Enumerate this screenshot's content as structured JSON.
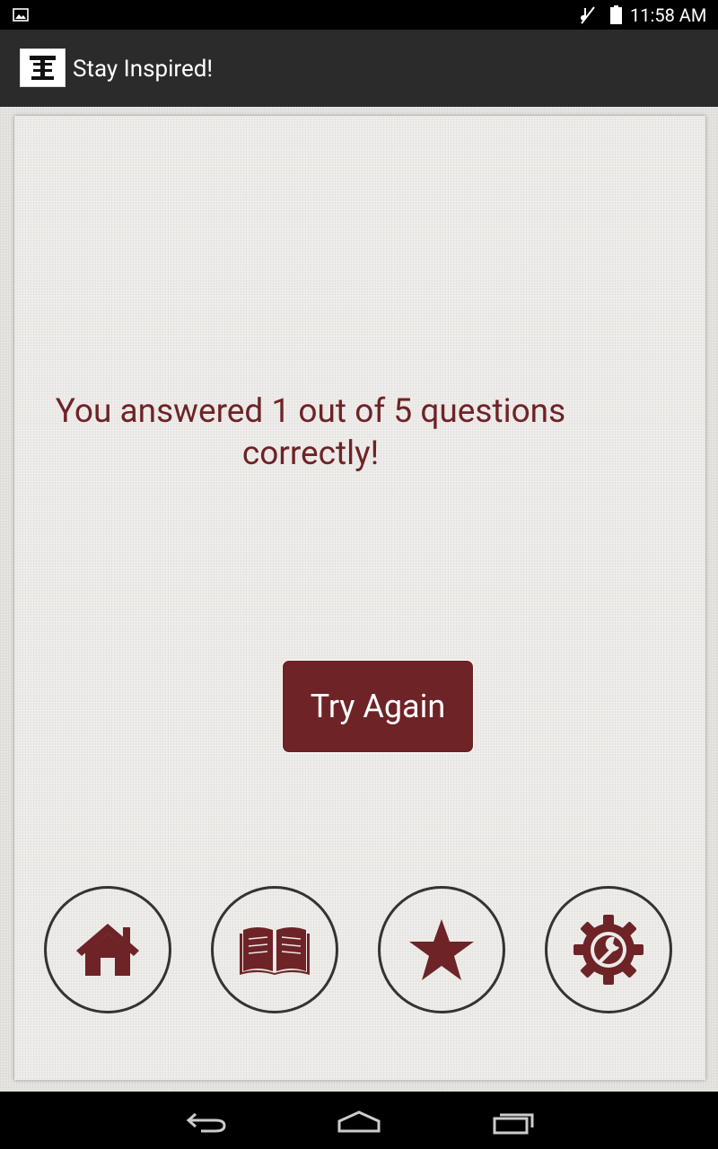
{
  "status_bar": {
    "time": "11:58 AM",
    "icons": [
      "image-notification-icon",
      "mute-icon",
      "battery-icon"
    ]
  },
  "action_bar": {
    "title": "Stay Inspired!",
    "logo_icon": "t-logo-icon"
  },
  "result": {
    "message": "You answered 1 out of 5 questions correctly!"
  },
  "buttons": {
    "try_again": "Try Again"
  },
  "bottom_nav": {
    "items": [
      {
        "name": "home",
        "icon": "home-icon"
      },
      {
        "name": "book",
        "icon": "book-icon"
      },
      {
        "name": "favorites",
        "icon": "star-icon"
      },
      {
        "name": "settings",
        "icon": "settings-gear-icon"
      }
    ]
  },
  "system_nav": [
    "back-icon",
    "home-button-icon",
    "recents-icon"
  ],
  "colors": {
    "accent": "#6e2327",
    "action_bar": "#2b2b2b",
    "background": "#e3e2de"
  }
}
